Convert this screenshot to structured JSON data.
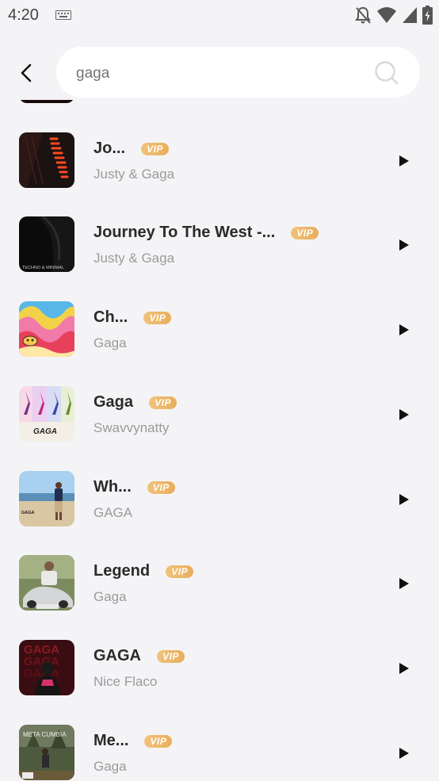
{
  "status_bar": {
    "time": "4:20",
    "icons": [
      "keyboard-icon",
      "bell-off-icon",
      "wifi-icon",
      "signal-icon",
      "battery-charging-icon"
    ]
  },
  "header": {
    "back_icon": "back-arrow-icon",
    "search": {
      "value": "",
      "placeholder": "gaga"
    },
    "search_icon": "search-icon"
  },
  "colors": {
    "background": "#f4f4f7",
    "vip_badge": "#efbb6e",
    "title_text": "#2a2a2a",
    "artist_text": "#9b9b9b"
  },
  "tracks": [
    {
      "title": "Jo...",
      "artist": "Justy & Gaga",
      "badge": "VIP"
    },
    {
      "title": "Journey To The West -...",
      "artist": "Justy & Gaga",
      "badge": "VIP"
    },
    {
      "title": "Ch...",
      "artist": "Gaga",
      "badge": "VIP"
    },
    {
      "title": "Gaga",
      "artist": "Swavvynatty",
      "badge": "VIP"
    },
    {
      "title": "Wh...",
      "artist": "GAGA",
      "badge": "VIP"
    },
    {
      "title": "Legend",
      "artist": "Gaga",
      "badge": "VIP"
    },
    {
      "title": "GAGA",
      "artist": "Nice Flaco",
      "badge": "VIP"
    },
    {
      "title": "Me...",
      "artist": "Gaga",
      "badge": "VIP"
    }
  ],
  "cover_labels": {
    "track_2": "TECHNO & MINIMAL",
    "track_4": "GAGA",
    "track_5": "GAGA",
    "track_7": "GAGA",
    "track_8": "META CUMBIA"
  }
}
